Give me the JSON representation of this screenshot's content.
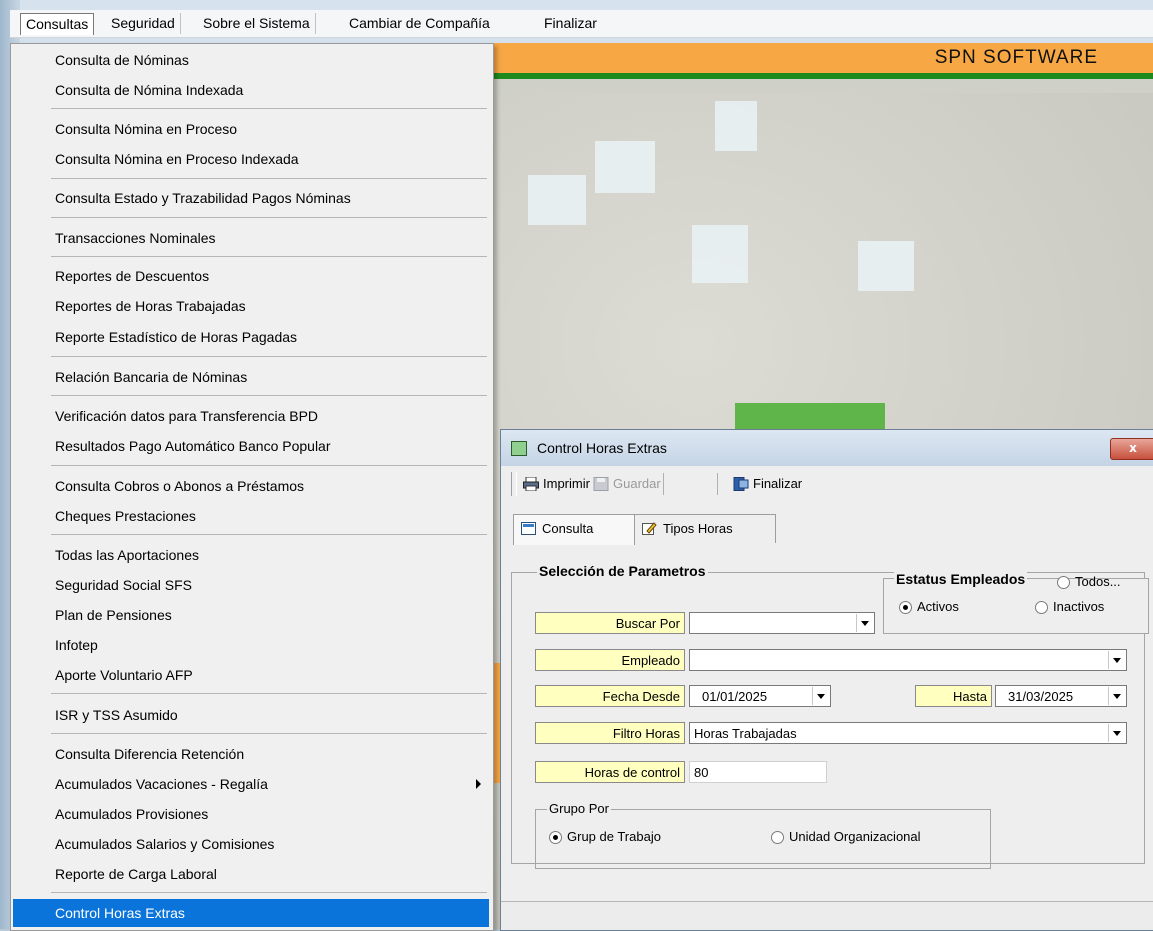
{
  "menubar": {
    "items": [
      "Consultas",
      "Seguridad",
      "Sobre el Sistema",
      "Cambiar de Compañía",
      "Finalizar"
    ]
  },
  "banner": {
    "title": "SPN SOFTWARE"
  },
  "menu": {
    "items": [
      "Consulta de Nóminas",
      "Consulta de Nómina Indexada",
      "Consulta Nómina en Proceso",
      "Consulta Nómina en Proceso Indexada",
      "Consulta Estado y Trazabilidad Pagos Nóminas",
      "Transacciones Nominales",
      "Reportes de Descuentos",
      "Reportes de Horas Trabajadas",
      "Reporte Estadístico de Horas Pagadas",
      "Relación Bancaria de Nóminas",
      "Verificación datos para Transferencia BPD",
      "Resultados Pago Automático Banco Popular",
      "Consulta Cobros o Abonos a Préstamos",
      "Cheques Prestaciones",
      "Todas las Aportaciones",
      "Seguridad Social SFS",
      "Plan de Pensiones",
      "Infotep",
      "Aporte Voluntario AFP",
      "ISR y TSS Asumido",
      "Consulta Diferencia Retención",
      "Acumulados Vacaciones - Regalía",
      "Acumulados Provisiones",
      "Acumulados Salarios y Comisiones",
      "Reporte de Carga Laboral",
      "Control Horas Extras"
    ]
  },
  "dialog": {
    "title": "Control Horas Extras",
    "close": "x",
    "toolbar": {
      "print": "Imprimir",
      "save": "Guardar",
      "exit": "Finalizar"
    },
    "tabs": [
      "Consulta",
      "Tipos Horas"
    ],
    "selection_title": "Selección de Parametros",
    "estatus": {
      "title": "Estatus Empleados",
      "todos": "Todos...",
      "activos": "Activos",
      "inactivos": "Inactivos"
    },
    "fields": {
      "buscar_por": {
        "label": "Buscar Por",
        "value": ""
      },
      "empleado": {
        "label": "Empleado",
        "value": ""
      },
      "fecha_desde": {
        "label": "Fecha Desde",
        "value": "01/01/2025"
      },
      "hasta": {
        "label": "Hasta",
        "value": "31/03/2025"
      },
      "filtro_horas": {
        "label": "Filtro Horas",
        "value": "Horas Trabajadas"
      },
      "horas_control": {
        "label": "Horas de control",
        "value": "80"
      }
    },
    "grupo": {
      "title": "Grupo Por",
      "opt1": "Grup de Trabajo",
      "opt2": "Unidad Organizacional"
    }
  }
}
